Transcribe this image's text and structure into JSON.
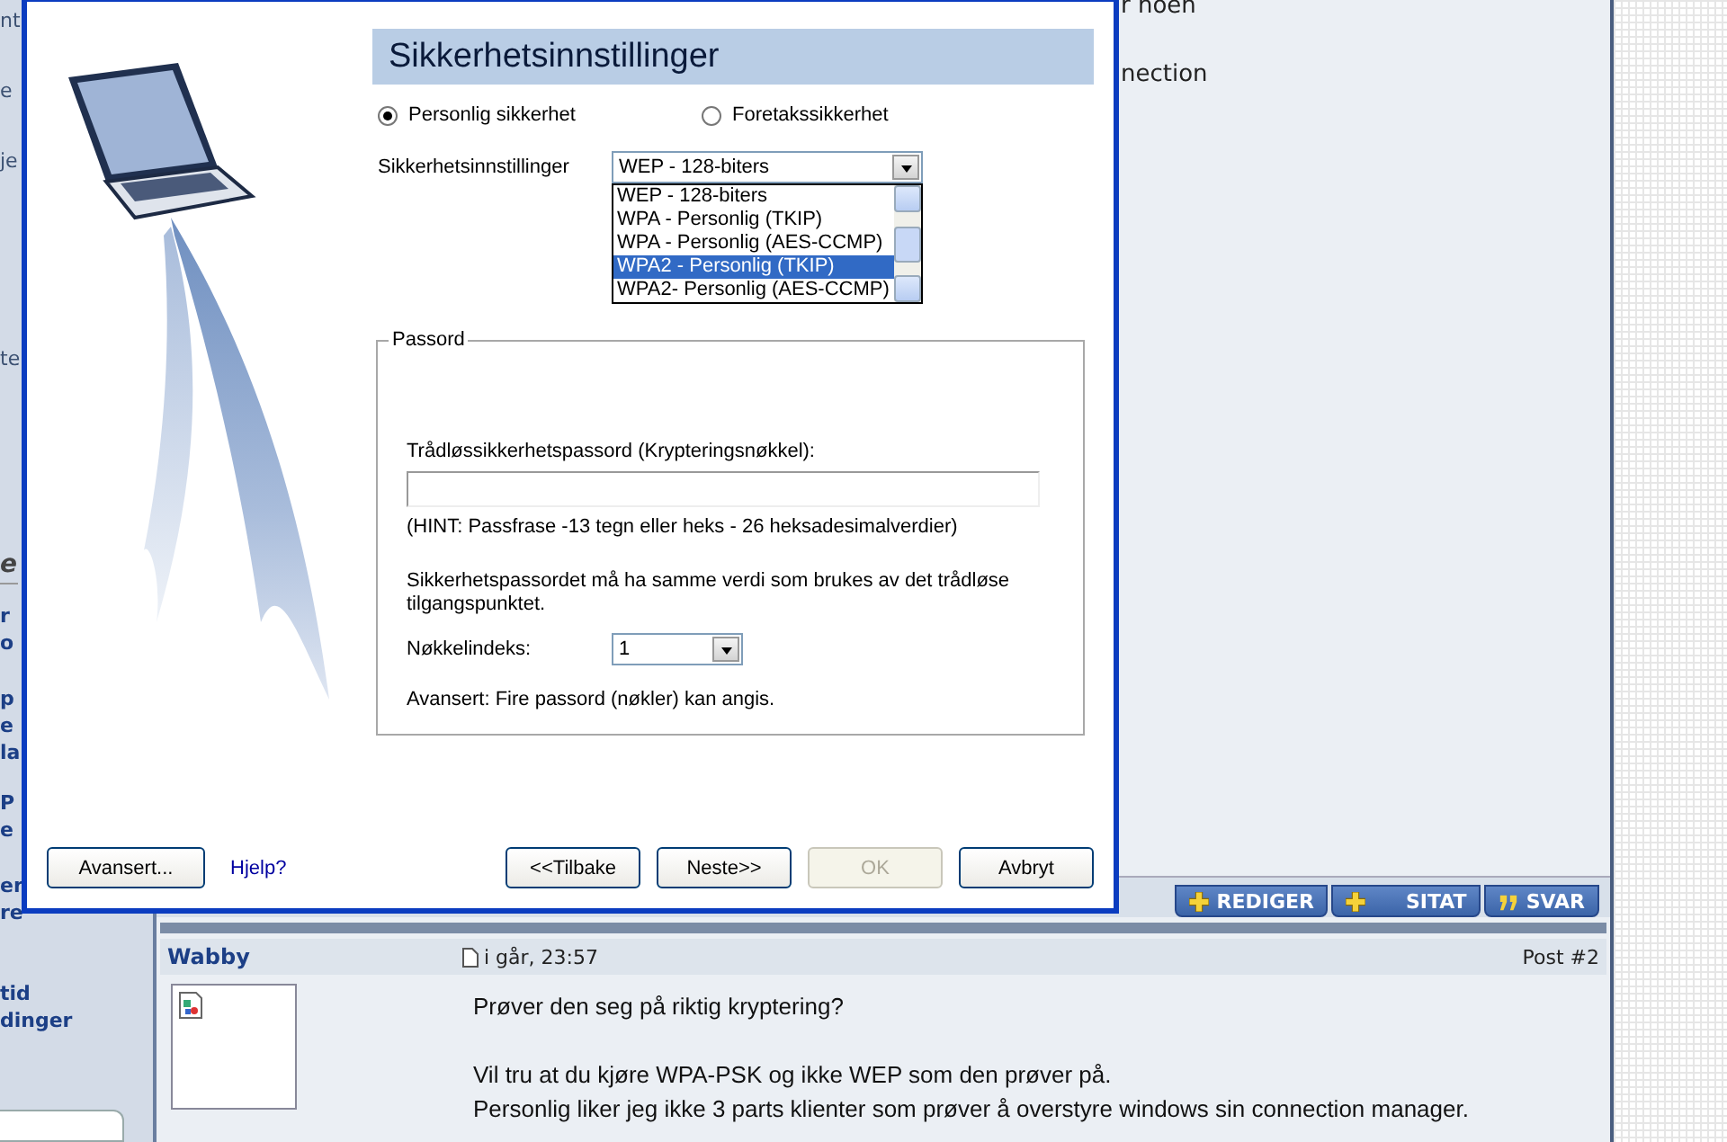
{
  "sidebar": [
    {
      "kind": "plain",
      "lines": [
        "nt"
      ]
    },
    {
      "kind": "plain",
      "lines": [
        "e"
      ]
    },
    {
      "kind": "plain",
      "lines": [
        "je"
      ]
    },
    {
      "kind": "plain",
      "lines": [
        "te"
      ]
    },
    {
      "kind": "heading",
      "lines": [
        "e"
      ]
    },
    {
      "kind": "link",
      "lines": [
        "r",
        "o"
      ]
    },
    {
      "kind": "link",
      "lines": [
        "p",
        "e",
        "la"
      ]
    },
    {
      "kind": "link",
      "lines": [
        "P",
        "e"
      ]
    },
    {
      "kind": "link",
      "lines": [
        "er",
        "re"
      ]
    },
    {
      "kind": "link",
      "lines": [
        "tid",
        "dinger"
      ]
    }
  ],
  "background_text": [
    "r noen",
    "nection"
  ],
  "post_actions": [
    {
      "label": "REDIGER",
      "kind": "plus"
    },
    {
      "label": "SITAT",
      "kind": "plus"
    },
    {
      "label": "SVAR",
      "kind": "quote"
    }
  ],
  "post": {
    "author": "Wabby",
    "time": "i går, 23:57",
    "number": "Post #2",
    "lines": [
      "Prøver den seg på riktig kryptering?",
      "Vil tru at du kjøre WPA-PSK og ikke WEP som den prøver på.",
      "Personlig liker jeg ikke 3 parts klienter som prøver å overstyre windows sin connection manager."
    ]
  },
  "dialog": {
    "title": "Sikkerhetsinnstillinger",
    "modes": [
      {
        "label": "Personlig sikkerhet",
        "selected": true
      },
      {
        "label": "Foretakssikkerhet",
        "selected": false
      }
    ],
    "security_label": "Sikkerhetsinnstillinger",
    "security_value": "WEP - 128-biters",
    "security_options": [
      {
        "label": "WEP - 128-biters",
        "selected": false
      },
      {
        "label": "WPA - Personlig (TKIP)",
        "selected": false
      },
      {
        "label": "WPA - Personlig (AES-CCMP)",
        "selected": false
      },
      {
        "label": "WPA2 - Personlig (TKIP)",
        "selected": true
      },
      {
        "label": "WPA2- Personlig (AES-CCMP)",
        "selected": false
      }
    ],
    "group_title": "Passord",
    "password_label": "Trådløssikkerhetspassord (Krypteringsnøkkel):",
    "hint": "(HINT: Passfrase -13 tegn eller heks - 26 heksadesimalverdier)",
    "note": "Sikkerhetspassordet må ha samme verdi som brukes av det trådløse tilgangspunktet.",
    "key_index_label": "Nøkkelindeks:",
    "key_index_value": "1",
    "advanced_note": "Avansert: Fire passord (nøkler) kan angis.",
    "buttons": [
      {
        "label": "Avansert...",
        "kind": "button",
        "disabled": false
      },
      {
        "label": "Hjelp?",
        "kind": "link",
        "disabled": false
      },
      {
        "label": "<<Tilbake",
        "kind": "button",
        "disabled": false
      },
      {
        "label": "Neste>>",
        "kind": "button",
        "disabled": false
      },
      {
        "label": "OK",
        "kind": "button",
        "disabled": true
      },
      {
        "label": "Avbryt",
        "kind": "button",
        "disabled": false
      }
    ]
  }
}
